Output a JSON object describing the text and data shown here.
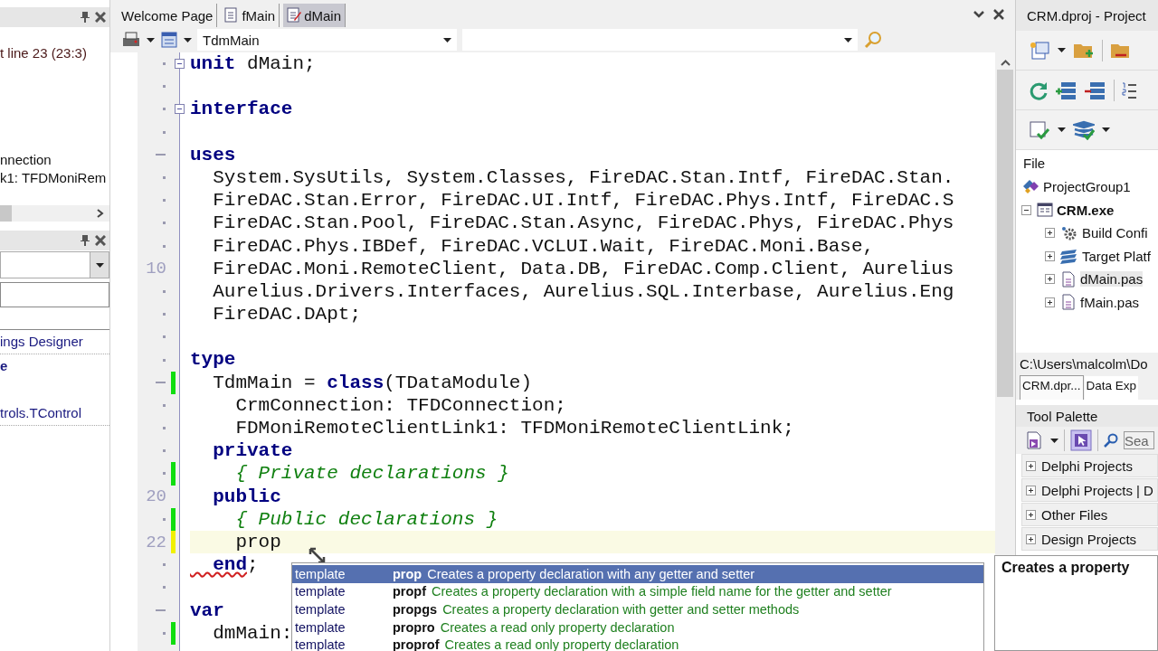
{
  "left_panel": {
    "location_text": "t line 23 (23:3)",
    "structure_items": [
      "nnection",
      "k1: TFDMoniRem"
    ],
    "object_links": [
      {
        "text": "ings Designer",
        "kind": "link"
      },
      {
        "text": "e",
        "kind": "bold"
      },
      {
        "text": "trols.TControl",
        "kind": "link"
      }
    ]
  },
  "editor": {
    "tabs": [
      {
        "label": "Welcome Page",
        "kind": "plain",
        "selected": false
      },
      {
        "label": "fMain",
        "kind": "unit",
        "selected": false
      },
      {
        "label": "dMain",
        "kind": "module",
        "selected": true
      }
    ],
    "class_selector": "TdmMain",
    "lines": [
      {
        "kind": "dot",
        "fold": true,
        "current": false,
        "segments": [
          {
            "text": "unit",
            "kind": "keyword"
          },
          {
            "text": " dMain;",
            "kind": "plain"
          }
        ]
      },
      {
        "kind": "dot",
        "fold": false,
        "current": false
      },
      {
        "kind": "dot",
        "fold": true,
        "current": false,
        "segments": [
          {
            "text": "interface",
            "kind": "keyword"
          }
        ]
      },
      {
        "kind": "dot",
        "fold": false,
        "current": false
      },
      {
        "kind": "dash",
        "fold": false,
        "current": false,
        "segments": [
          {
            "text": "uses",
            "kind": "keyword"
          }
        ]
      },
      {
        "kind": "dot",
        "fold": false,
        "current": false,
        "segments": [
          {
            "text": "  System.SysUtils, System.Classes, FireDAC.Stan.Intf, FireDAC.Stan.",
            "kind": "plain"
          }
        ]
      },
      {
        "kind": "dot",
        "fold": false,
        "current": false,
        "segments": [
          {
            "text": "  FireDAC.Stan.Error, FireDAC.UI.Intf, FireDAC.Phys.Intf, FireDAC.S",
            "kind": "plain"
          }
        ]
      },
      {
        "kind": "dot",
        "fold": false,
        "current": false,
        "segments": [
          {
            "text": "  FireDAC.Stan.Pool, FireDAC.Stan.Async, FireDAC.Phys, FireDAC.Phys",
            "kind": "plain"
          }
        ]
      },
      {
        "kind": "dot",
        "fold": false,
        "current": false,
        "segments": [
          {
            "text": "  FireDAC.Phys.IBDef, FireDAC.VCLUI.Wait, FireDAC.Moni.Base,",
            "kind": "plain"
          }
        ]
      },
      {
        "kind": "number",
        "number": "10",
        "fold": false,
        "current": false,
        "segments": [
          {
            "text": "  FireDAC.Moni.RemoteClient, Data.DB, FireDAC.Comp.Client, Aurelius",
            "kind": "plain"
          }
        ]
      },
      {
        "kind": "dot",
        "fold": false,
        "current": false,
        "segments": [
          {
            "text": "  Aurelius.Drivers.Interfaces, Aurelius.SQL.Interbase, Aurelius.Eng",
            "kind": "plain"
          }
        ]
      },
      {
        "kind": "dot",
        "fold": false,
        "current": false,
        "segments": [
          {
            "text": "  FireDAC.DApt;",
            "kind": "plain"
          }
        ]
      },
      {
        "kind": "dot",
        "fold": false,
        "current": false
      },
      {
        "kind": "dot",
        "fold": false,
        "current": false,
        "segments": [
          {
            "text": "type",
            "kind": "keyword"
          }
        ]
      },
      {
        "kind": "dash",
        "saved": true,
        "fold": false,
        "current": false,
        "segments": [
          {
            "text": "  TdmMain = ",
            "kind": "plain"
          },
          {
            "text": "class",
            "kind": "keyword"
          },
          {
            "text": "(TDataModule)",
            "kind": "plain"
          }
        ]
      },
      {
        "kind": "dot",
        "fold": false,
        "current": false,
        "segments": [
          {
            "text": "    CrmConnection: TFDConnection;",
            "kind": "plain"
          }
        ]
      },
      {
        "kind": "dot",
        "fold": false,
        "current": false,
        "segments": [
          {
            "text": "    FDMoniRemoteClientLink1: TFDMoniRemoteClientLink;",
            "kind": "plain"
          }
        ]
      },
      {
        "kind": "dot",
        "fold": false,
        "current": false,
        "segments": [
          {
            "text": "  private",
            "kind": "keyword"
          }
        ]
      },
      {
        "kind": "dot",
        "saved": true,
        "fold": false,
        "current": false,
        "segments": [
          {
            "text": "    { Private declarations }",
            "kind": "comment"
          }
        ]
      },
      {
        "kind": "number",
        "number": "20",
        "fold": false,
        "current": false,
        "segments": [
          {
            "text": "  public",
            "kind": "keyword"
          }
        ]
      },
      {
        "kind": "dot",
        "saved": true,
        "fold": false,
        "current": false,
        "segments": [
          {
            "text": "    { Public declarations }",
            "kind": "comment"
          }
        ]
      },
      {
        "kind": "number",
        "number": "22",
        "modified": true,
        "fold": false,
        "current": true,
        "segments": [
          {
            "text": "    prop",
            "kind": "plain"
          }
        ]
      },
      {
        "kind": "dot",
        "fold": false,
        "current": false,
        "segments": [
          {
            "text": "  end",
            "kind": "error_keyword"
          },
          {
            "text": ";",
            "kind": "plain"
          }
        ]
      },
      {
        "kind": "dot",
        "fold": false,
        "current": false
      },
      {
        "kind": "dash",
        "fold": false,
        "current": false,
        "segments": [
          {
            "text": "var",
            "kind": "keyword"
          }
        ]
      },
      {
        "kind": "dot",
        "saved": true,
        "fold": false,
        "current": false,
        "segments": [
          {
            "text": "  dmMain:",
            "kind": "plain"
          }
        ]
      }
    ],
    "completion": [
      {
        "category": "template",
        "name": "prop",
        "description": "Creates a property declaration with any getter and setter",
        "selected": true
      },
      {
        "category": "template",
        "name": "propf",
        "description": "Creates a property declaration with a simple field name for the getter and setter",
        "selected": false
      },
      {
        "category": "template",
        "name": "propgs",
        "description": "Creates a property declaration with getter and setter methods",
        "selected": false
      },
      {
        "category": "template",
        "name": "propro",
        "description": "Creates a read only property declaration",
        "selected": false
      },
      {
        "category": "template",
        "name": "proprof",
        "description": "Creates a read only property declaration",
        "selected": false
      }
    ],
    "hint": "Creates a property"
  },
  "project_manager": {
    "title": "CRM.dproj - Project",
    "column": "File",
    "tree": [
      {
        "label": "ProjectGroup1",
        "kind": "group",
        "selected": false,
        "children": [
          {
            "label": "CRM.exe",
            "kind": "project",
            "expanded": true,
            "selected": false,
            "children": [
              {
                "label": "Build Confi",
                "kind": "config",
                "expanded": false,
                "selected": false
              },
              {
                "label": "Target Platf",
                "kind": "platform",
                "expanded": false,
                "selected": false
              },
              {
                "label": "dMain.pas",
                "kind": "file",
                "expanded": false,
                "selected": true
              },
              {
                "label": "fMain.pas",
                "kind": "file",
                "expanded": false,
                "selected": false
              }
            ]
          }
        ]
      }
    ],
    "path": "C:\\Users\\malcolm\\Do",
    "tabs": [
      {
        "label": "CRM.dpr...",
        "selected": true
      },
      {
        "label": "Data Exp",
        "selected": false
      }
    ]
  },
  "tool_palette": {
    "title": "Tool Palette",
    "search": {
      "placeholder": "Sea"
    },
    "categories": [
      "Delphi Projects",
      "Delphi Projects | D",
      "Other Files",
      "Design Projects"
    ]
  }
}
